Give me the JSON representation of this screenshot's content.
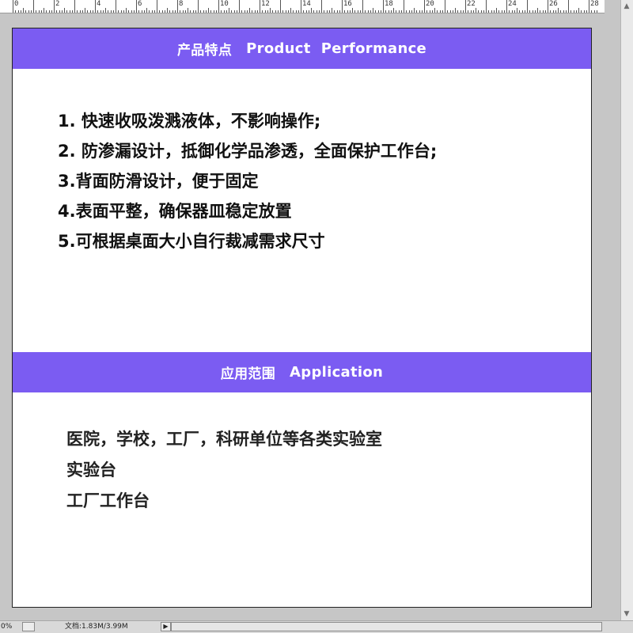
{
  "ruler": {
    "labels": [
      "0",
      "2",
      "4",
      "6",
      "8",
      "10",
      "12",
      "14",
      "16",
      "18",
      "20",
      "22",
      "24",
      "26",
      "28"
    ]
  },
  "banner1": {
    "cn": "产品特点",
    "en": "Product  Performance"
  },
  "features": [
    "1. 快速收吸泼溅液体，不影响操作;",
    "2. 防渗漏设计，抵御化学品渗透，全面保护工作台;",
    "3.背面防滑设计，便于固定",
    "4.表面平整，确保器皿稳定放置",
    "5.可根据桌面大小自行裁减需求尺寸"
  ],
  "banner2": {
    "cn": "应用范围",
    "en": "Application"
  },
  "applications": [
    "医院，学校，工厂，科研单位等各类实验室",
    "实验台",
    "工厂工作台"
  ],
  "status": {
    "zoom": "0%",
    "doc": "文档:1.83M/3.99M"
  },
  "colors": {
    "banner": "#7b5cf2",
    "canvas": "#ffffff",
    "workspace": "#c6c6c6"
  },
  "icons": {
    "scroll_up": "▲",
    "scroll_down": "▼",
    "nav_right": "▶",
    "nav_left": "◀"
  }
}
